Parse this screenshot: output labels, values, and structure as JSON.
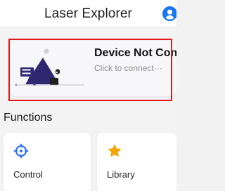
{
  "header": {
    "title": "Laser Explorer",
    "avatar_icon": "user-icon"
  },
  "device_card": {
    "title": "Device Not Connected",
    "subtitle": "Click to connect···",
    "illustration": "device-illustration"
  },
  "functions": {
    "title": "Functions",
    "items": [
      {
        "label": "Control",
        "icon": "crosshair-icon",
        "color": "#2f74f6"
      },
      {
        "label": "Library",
        "icon": "star-icon",
        "color": "#f5a400"
      }
    ]
  },
  "colors": {
    "accent": "#1976f3",
    "highlight": "#e1181c"
  }
}
